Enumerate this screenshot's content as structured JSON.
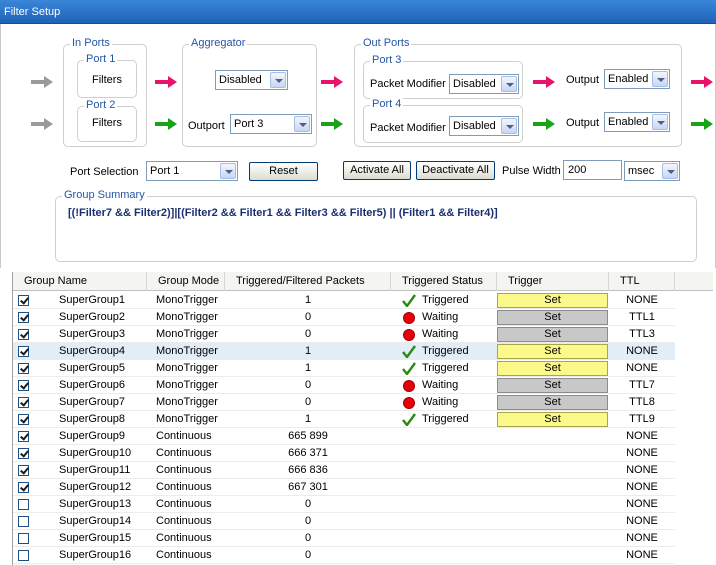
{
  "window": {
    "title": "Filter Setup"
  },
  "in_ports": {
    "title": "In Ports",
    "ports": [
      {
        "title": "Port 1",
        "label": "Filters"
      },
      {
        "title": "Port 2",
        "label": "Filters"
      }
    ]
  },
  "aggregator": {
    "title": "Aggregator",
    "mode_value": "Disabled",
    "outport_label": "Outport",
    "outport_value": "Port 3"
  },
  "out_ports": {
    "title": "Out Ports",
    "ports": [
      {
        "title": "Port 3",
        "modifier_label": "Packet Modifier",
        "modifier_value": "Disabled",
        "output_label": "Output",
        "output_value": "Enabled"
      },
      {
        "title": "Port 4",
        "modifier_label": "Packet Modifier",
        "modifier_value": "Disabled",
        "output_label": "Output",
        "output_value": "Enabled"
      }
    ]
  },
  "controls": {
    "port_selection_label": "Port Selection",
    "port_selection_value": "Port 1",
    "reset_label": "Reset",
    "activate_all_label": "Activate All",
    "deactivate_all_label": "Deactivate All",
    "pulse_width_label": "Pulse Width",
    "pulse_width_value": "200",
    "pulse_unit_value": "msec"
  },
  "group_summary": {
    "title": "Group Summary",
    "expression": "[(!Filter7 && Filter2)]|[(Filter2 && Filter1 && Filter3 && Filter5) || (Filter1 && Filter4)]"
  },
  "table": {
    "columns": [
      "Group Name",
      "Group Mode",
      "Triggered/Filtered Packets",
      "Triggered Status",
      "Trigger",
      "TTL"
    ],
    "rows": [
      {
        "checked": true,
        "name": "SuperGroup1",
        "mode": "MonoTrigger",
        "packets": "1",
        "status": "Triggered",
        "trigger": "Set",
        "trigger_color": "yellow",
        "ttl": "NONE"
      },
      {
        "checked": true,
        "name": "SuperGroup2",
        "mode": "MonoTrigger",
        "packets": "0",
        "status": "Waiting",
        "trigger": "Set",
        "trigger_color": "gray",
        "ttl": "TTL1"
      },
      {
        "checked": true,
        "name": "SuperGroup3",
        "mode": "MonoTrigger",
        "packets": "0",
        "status": "Waiting",
        "trigger": "Set",
        "trigger_color": "gray",
        "ttl": "TTL3"
      },
      {
        "checked": true,
        "name": "SuperGroup4",
        "mode": "MonoTrigger",
        "packets": "1",
        "status": "Triggered",
        "trigger": "Set",
        "trigger_color": "yellow",
        "ttl": "NONE"
      },
      {
        "checked": true,
        "name": "SuperGroup5",
        "mode": "MonoTrigger",
        "packets": "1",
        "status": "Triggered",
        "trigger": "Set",
        "trigger_color": "yellow",
        "ttl": "NONE"
      },
      {
        "checked": true,
        "name": "SuperGroup6",
        "mode": "MonoTrigger",
        "packets": "0",
        "status": "Waiting",
        "trigger": "Set",
        "trigger_color": "gray",
        "ttl": "TTL7"
      },
      {
        "checked": true,
        "name": "SuperGroup7",
        "mode": "MonoTrigger",
        "packets": "0",
        "status": "Waiting",
        "trigger": "Set",
        "trigger_color": "gray",
        "ttl": "TTL8"
      },
      {
        "checked": true,
        "name": "SuperGroup8",
        "mode": "MonoTrigger",
        "packets": "1",
        "status": "Triggered",
        "trigger": "Set",
        "trigger_color": "yellow",
        "ttl": "TTL9"
      },
      {
        "checked": true,
        "name": "SuperGroup9",
        "mode": "Continuous",
        "packets": "665 899",
        "status": "",
        "trigger": "",
        "trigger_color": "",
        "ttl": "NONE"
      },
      {
        "checked": true,
        "name": "SuperGroup10",
        "mode": "Continuous",
        "packets": "666 371",
        "status": "",
        "trigger": "",
        "trigger_color": "",
        "ttl": "NONE"
      },
      {
        "checked": true,
        "name": "SuperGroup11",
        "mode": "Continuous",
        "packets": "666 836",
        "status": "",
        "trigger": "",
        "trigger_color": "",
        "ttl": "NONE"
      },
      {
        "checked": true,
        "name": "SuperGroup12",
        "mode": "Continuous",
        "packets": "667 301",
        "status": "",
        "trigger": "",
        "trigger_color": "",
        "ttl": "NONE"
      },
      {
        "checked": false,
        "name": "SuperGroup13",
        "mode": "Continuous",
        "packets": "0",
        "status": "",
        "trigger": "",
        "trigger_color": "",
        "ttl": "NONE"
      },
      {
        "checked": false,
        "name": "SuperGroup14",
        "mode": "Continuous",
        "packets": "0",
        "status": "",
        "trigger": "",
        "trigger_color": "",
        "ttl": "NONE"
      },
      {
        "checked": false,
        "name": "SuperGroup15",
        "mode": "Continuous",
        "packets": "0",
        "status": "",
        "trigger": "",
        "trigger_color": "",
        "ttl": "NONE"
      },
      {
        "checked": false,
        "name": "SuperGroup16",
        "mode": "Continuous",
        "packets": "0",
        "status": "",
        "trigger": "",
        "trigger_color": "",
        "ttl": "NONE"
      }
    ]
  },
  "colors": {
    "pink_arrow": "#e8136b",
    "green_arrow": "#19a319",
    "gray_arrow": "#9a9a9a",
    "set_yellow": "#fbf98a",
    "set_gray": "#c8c8c8",
    "status_check": "#2a8a10",
    "status_wait": "#e8000a"
  },
  "icons": {
    "status_triggered": "check-icon",
    "status_waiting": "red-dot-icon",
    "flow_arrow": "right-arrow-icon"
  }
}
